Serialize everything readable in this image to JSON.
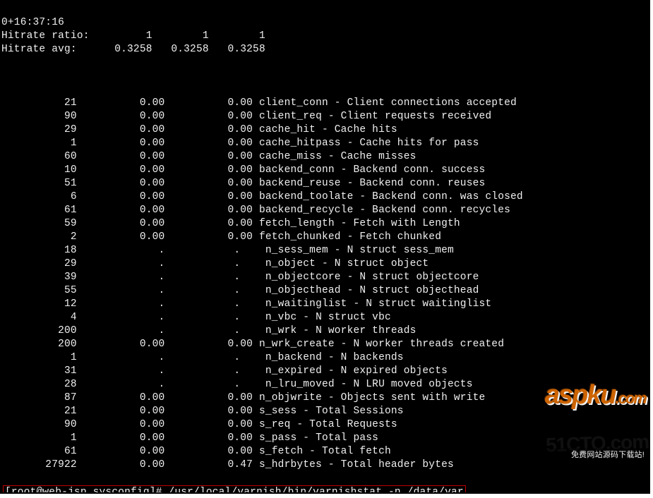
{
  "header": {
    "uptime": "0+16:37:16",
    "hitrate_ratio_label": "Hitrate ratio:",
    "hitrate_ratio": [
      "1",
      "1",
      "1"
    ],
    "hitrate_avg_label": "Hitrate avg:",
    "hitrate_avg": [
      "0.3258",
      "0.3258",
      "0.3258"
    ]
  },
  "stats": [
    {
      "v1": "21",
      "v2": "0.00",
      "v3": "0.00",
      "name": "client_conn - Client connections accepted"
    },
    {
      "v1": "90",
      "v2": "0.00",
      "v3": "0.00",
      "name": "client_req - Client requests received"
    },
    {
      "v1": "29",
      "v2": "0.00",
      "v3": "0.00",
      "name": "cache_hit - Cache hits"
    },
    {
      "v1": "1",
      "v2": "0.00",
      "v3": "0.00",
      "name": "cache_hitpass - Cache hits for pass"
    },
    {
      "v1": "60",
      "v2": "0.00",
      "v3": "0.00",
      "name": "cache_miss - Cache misses"
    },
    {
      "v1": "10",
      "v2": "0.00",
      "v3": "0.00",
      "name": "backend_conn - Backend conn. success"
    },
    {
      "v1": "51",
      "v2": "0.00",
      "v3": "0.00",
      "name": "backend_reuse - Backend conn. reuses"
    },
    {
      "v1": "6",
      "v2": "0.00",
      "v3": "0.00",
      "name": "backend_toolate - Backend conn. was closed"
    },
    {
      "v1": "61",
      "v2": "0.00",
      "v3": "0.00",
      "name": "backend_recycle - Backend conn. recycles"
    },
    {
      "v1": "59",
      "v2": "0.00",
      "v3": "0.00",
      "name": "fetch_length - Fetch with Length"
    },
    {
      "v1": "2",
      "v2": "0.00",
      "v3": "0.00",
      "name": "fetch_chunked - Fetch chunked"
    },
    {
      "v1": "18",
      "v2": ".",
      "v3": ".  ",
      "name": " n_sess_mem - N struct sess_mem"
    },
    {
      "v1": "29",
      "v2": ".",
      "v3": ".  ",
      "name": " n_object - N struct object"
    },
    {
      "v1": "39",
      "v2": ".",
      "v3": ".  ",
      "name": " n_objectcore - N struct objectcore"
    },
    {
      "v1": "55",
      "v2": ".",
      "v3": ".  ",
      "name": " n_objecthead - N struct objecthead"
    },
    {
      "v1": "12",
      "v2": ".",
      "v3": ".  ",
      "name": " n_waitinglist - N struct waitinglist"
    },
    {
      "v1": "4",
      "v2": ".",
      "v3": ".  ",
      "name": " n_vbc - N struct vbc"
    },
    {
      "v1": "200",
      "v2": ".",
      "v3": ".  ",
      "name": " n_wrk - N worker threads"
    },
    {
      "v1": "200",
      "v2": "0.00",
      "v3": "0.00",
      "name": "n_wrk_create - N worker threads created"
    },
    {
      "v1": "1",
      "v2": ".",
      "v3": ".  ",
      "name": " n_backend - N backends"
    },
    {
      "v1": "31",
      "v2": ".",
      "v3": ".  ",
      "name": " n_expired - N expired objects"
    },
    {
      "v1": "28",
      "v2": ".",
      "v3": ".  ",
      "name": " n_lru_moved - N LRU moved objects"
    },
    {
      "v1": "87",
      "v2": "0.00",
      "v3": "0.00",
      "name": "n_objwrite - Objects sent with write"
    },
    {
      "v1": "21",
      "v2": "0.00",
      "v3": "0.00",
      "name": "s_sess - Total Sessions"
    },
    {
      "v1": "90",
      "v2": "0.00",
      "v3": "0.00",
      "name": "s_req - Total Requests"
    },
    {
      "v1": "1",
      "v2": "0.00",
      "v3": "0.00",
      "name": "s_pass - Total pass"
    },
    {
      "v1": "61",
      "v2": "0.00",
      "v3": "0.00",
      "name": "s_fetch - Total fetch"
    },
    {
      "v1": "27922",
      "v2": "0.00",
      "v3": "0.47",
      "name": "s_hdrbytes - Total header bytes"
    }
  ],
  "prompt": {
    "user_host": "[root@web-jsp sysconfig]#",
    "command": " /usr/local/varnish/bin/varnishstat -n /data/var"
  },
  "watermark": {
    "logo": "aspku",
    "suffix": ".com",
    "tagline": "免费网站源码下载站!"
  },
  "faded_mark": "51CTO.com"
}
